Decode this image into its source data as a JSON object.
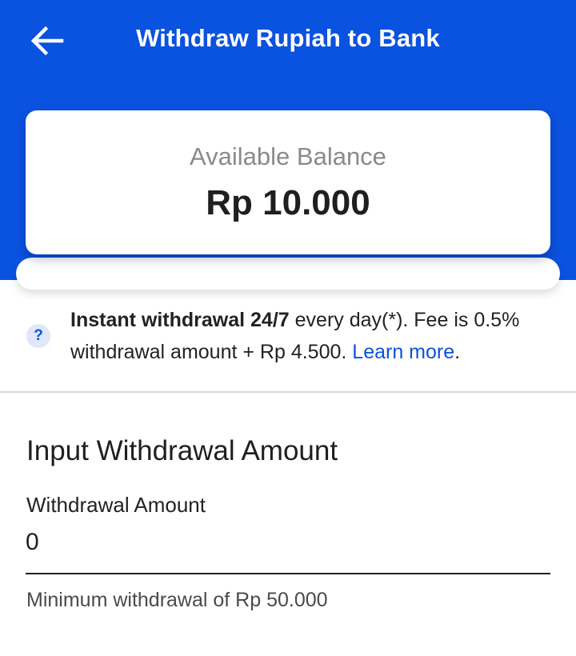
{
  "header": {
    "title": "Withdraw Rupiah to Bank",
    "back_icon": "arrow-left-icon"
  },
  "balance": {
    "label": "Available Balance",
    "amount": "Rp 10.000"
  },
  "info": {
    "icon": "question-icon",
    "icon_glyph": "?",
    "bold_text": "Instant withdrawal 24/7",
    "text": " every day(*). Fee is 0.5% withdrawal amount + Rp 4.500. ",
    "link": "Learn more",
    "link_suffix": "."
  },
  "form": {
    "section_title": "Input Withdrawal Amount",
    "field_label": "Withdrawal Amount",
    "field_value": "0",
    "helper": "Minimum withdrawal of Rp 50.000"
  },
  "colors": {
    "primary": "#0a52e0",
    "text": "#212121",
    "muted": "#8a8a8a"
  }
}
